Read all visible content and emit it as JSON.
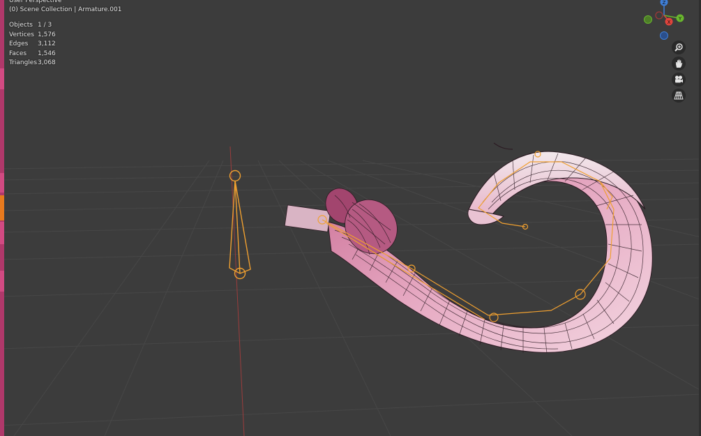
{
  "viewport": {
    "view_name": "User Perspective",
    "collection_label": "(0) Scene Collection | Armature.001"
  },
  "stats": [
    {
      "label": "Objects",
      "value": "1 / 3"
    },
    {
      "label": "Vertices",
      "value": "1,576"
    },
    {
      "label": "Edges",
      "value": "3,112"
    },
    {
      "label": "Faces",
      "value": "1,546"
    },
    {
      "label": "Triangles",
      "value": "3,068"
    }
  ],
  "gizmo": {
    "z_label": "Z",
    "y_label": "Y",
    "x_label": "X",
    "x_color": "#e0443c",
    "y_color": "#6ab82e",
    "z_color": "#3f7fd8"
  },
  "nav_buttons": [
    {
      "icon": "zoom-icon"
    },
    {
      "icon": "hand-pan-icon"
    },
    {
      "icon": "camera-icon"
    },
    {
      "icon": "grid-perspective-icon"
    }
  ],
  "colors": {
    "background": "#3c3c3c",
    "mesh_fill": "#e8b0c8",
    "mesh_wire": "#2b1a22",
    "armature": "#f0a030",
    "sidebar_accent": "#b0386a",
    "active_tab": "#e87a1e"
  }
}
